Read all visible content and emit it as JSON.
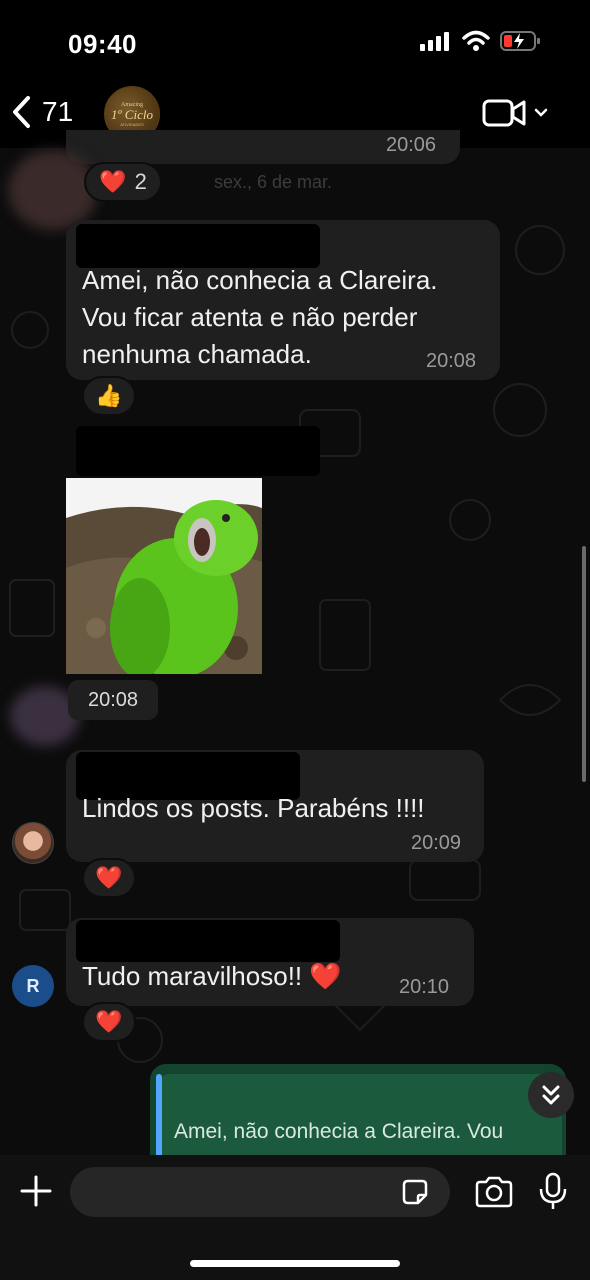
{
  "status_bar": {
    "time": "09:40"
  },
  "header": {
    "back_count": "71"
  },
  "group_avatar": {
    "line1": "Amazing",
    "line2": "1º Ciclo",
    "line3": "ATIVIDADES"
  },
  "messages": [
    {
      "id": "m0",
      "time": "20:06",
      "reaction": "2",
      "reaction_icon": "heart-icon"
    },
    {
      "id": "m1",
      "lines": [
        "Amei, não conhecia a Clareira.",
        "Vou ficar atenta e não perder",
        "nenhuma chamada."
      ],
      "time": "20:08",
      "reaction_icon": "thumbs-up-icon"
    },
    {
      "id": "m2",
      "type": "sticker",
      "time": "20:08"
    },
    {
      "id": "m3",
      "lines": [
        "Lindos os posts. Parabéns !!!!"
      ],
      "time": "20:09",
      "reaction_icon": "heart-icon"
    },
    {
      "id": "m4",
      "lines": [
        "Tudo maravilhoso!! ❤️"
      ],
      "time": "20:10",
      "avatar_letter": "R",
      "reaction_icon": "heart-icon"
    }
  ],
  "floating_header": "sex., 6 de mar.",
  "reply_preview": {
    "text": "Amei, não conhecia a Clareira. Vou"
  },
  "composer": {
    "placeholder": ""
  },
  "colors": {
    "bubble": "#1f1f1f",
    "reply_card": "#134430",
    "accent_blue": "#53a6ff",
    "avatar_r": "#1a4d8a"
  }
}
